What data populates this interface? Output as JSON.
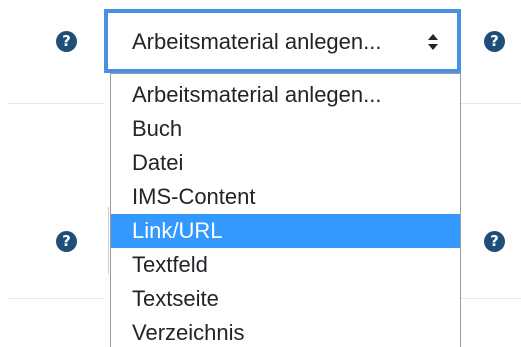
{
  "select": {
    "value": "Arbeitsmaterial anlegen...",
    "caret_icon": "sort-caret-icon"
  },
  "help_icon": {
    "glyph": "?",
    "icon": "question-circle-icon"
  },
  "dropdown": {
    "options": [
      {
        "label": "Arbeitsmaterial anlegen...",
        "selected": false
      },
      {
        "label": "Buch",
        "selected": false
      },
      {
        "label": "Datei",
        "selected": false
      },
      {
        "label": "IMS-Content",
        "selected": false
      },
      {
        "label": "Link/URL",
        "selected": true
      },
      {
        "label": "Textfeld",
        "selected": false
      },
      {
        "label": "Textseite",
        "selected": false
      },
      {
        "label": "Verzeichnis",
        "selected": false
      }
    ]
  },
  "colors": {
    "focus_border": "#4a90e2",
    "highlight": "#3399ff",
    "help_icon": "#1f4e79"
  }
}
